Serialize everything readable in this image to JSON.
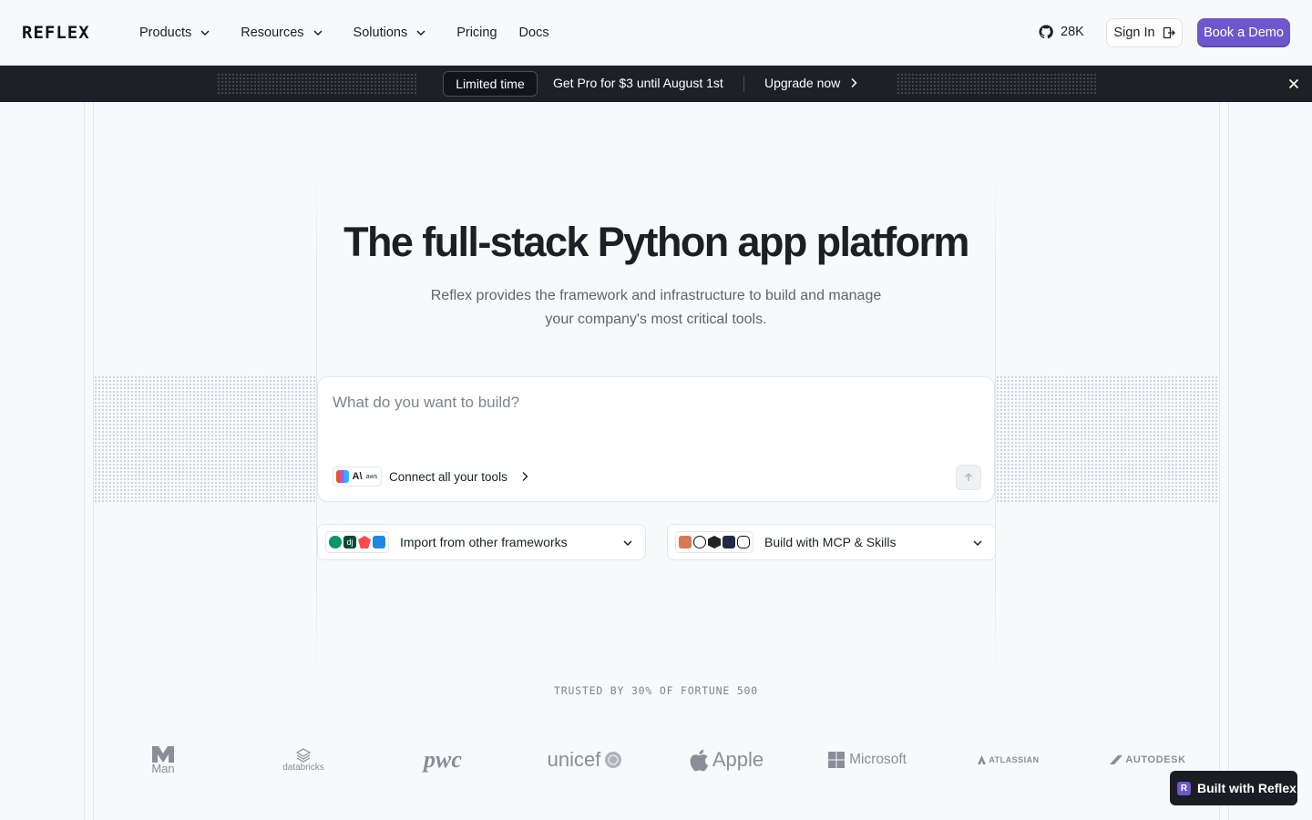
{
  "nav": {
    "logo": "REFLEX",
    "items": [
      {
        "label": "Products",
        "has_dropdown": true
      },
      {
        "label": "Resources",
        "has_dropdown": true
      },
      {
        "label": "Solutions",
        "has_dropdown": true
      },
      {
        "label": "Pricing",
        "has_dropdown": false
      },
      {
        "label": "Docs",
        "has_dropdown": false
      }
    ],
    "github_stars": "28K",
    "sign_in": "Sign In",
    "book_demo": "Book a Demo",
    "accent": "#6e56cf"
  },
  "banner": {
    "badge": "Limited time",
    "promo": "Get Pro for $3 until August 1st",
    "cta": "Upgrade now"
  },
  "hero": {
    "title": "The full-stack Python app platform",
    "subtitle_line1": "Reflex provides the framework and infrastructure to build and manage",
    "subtitle_line2": "your company's most critical tools."
  },
  "prompt": {
    "placeholder": "What do you want to build?",
    "tools_label": "Connect all your tools"
  },
  "dropdowns": {
    "import_label": "Import from other frameworks",
    "mcp_label": "Build with MCP & Skills"
  },
  "trusted": {
    "label": "TRUSTED BY 30% OF FORTUNE 500",
    "logos": [
      "Man",
      "databricks",
      "pwc",
      "unicef",
      "Apple",
      "Microsoft",
      "ATLASSIAN",
      "AUTODESK"
    ]
  },
  "built_with": "Built with Reflex"
}
